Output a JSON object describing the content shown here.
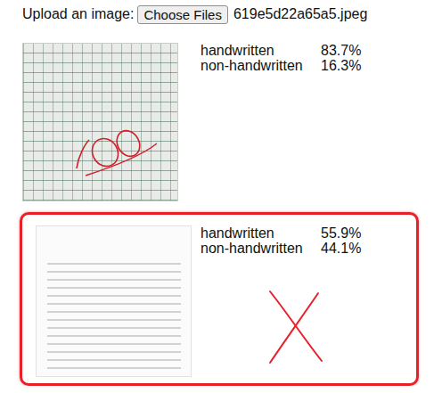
{
  "upload": {
    "label": "Upload an image:",
    "button": "Choose Files",
    "filename": "619e5d22a65a5.jpeg"
  },
  "results": [
    {
      "kind": "handwritten-sheet",
      "flagged": false,
      "predictions": [
        {
          "label": "handwritten",
          "value": "83.7%"
        },
        {
          "label": "non-handwritten",
          "value": "16.3%"
        }
      ]
    },
    {
      "kind": "printed-page",
      "flagged": true,
      "predictions": [
        {
          "label": "handwritten",
          "value": "55.9%"
        },
        {
          "label": "non-handwritten",
          "value": "44.1%"
        }
      ]
    }
  ]
}
